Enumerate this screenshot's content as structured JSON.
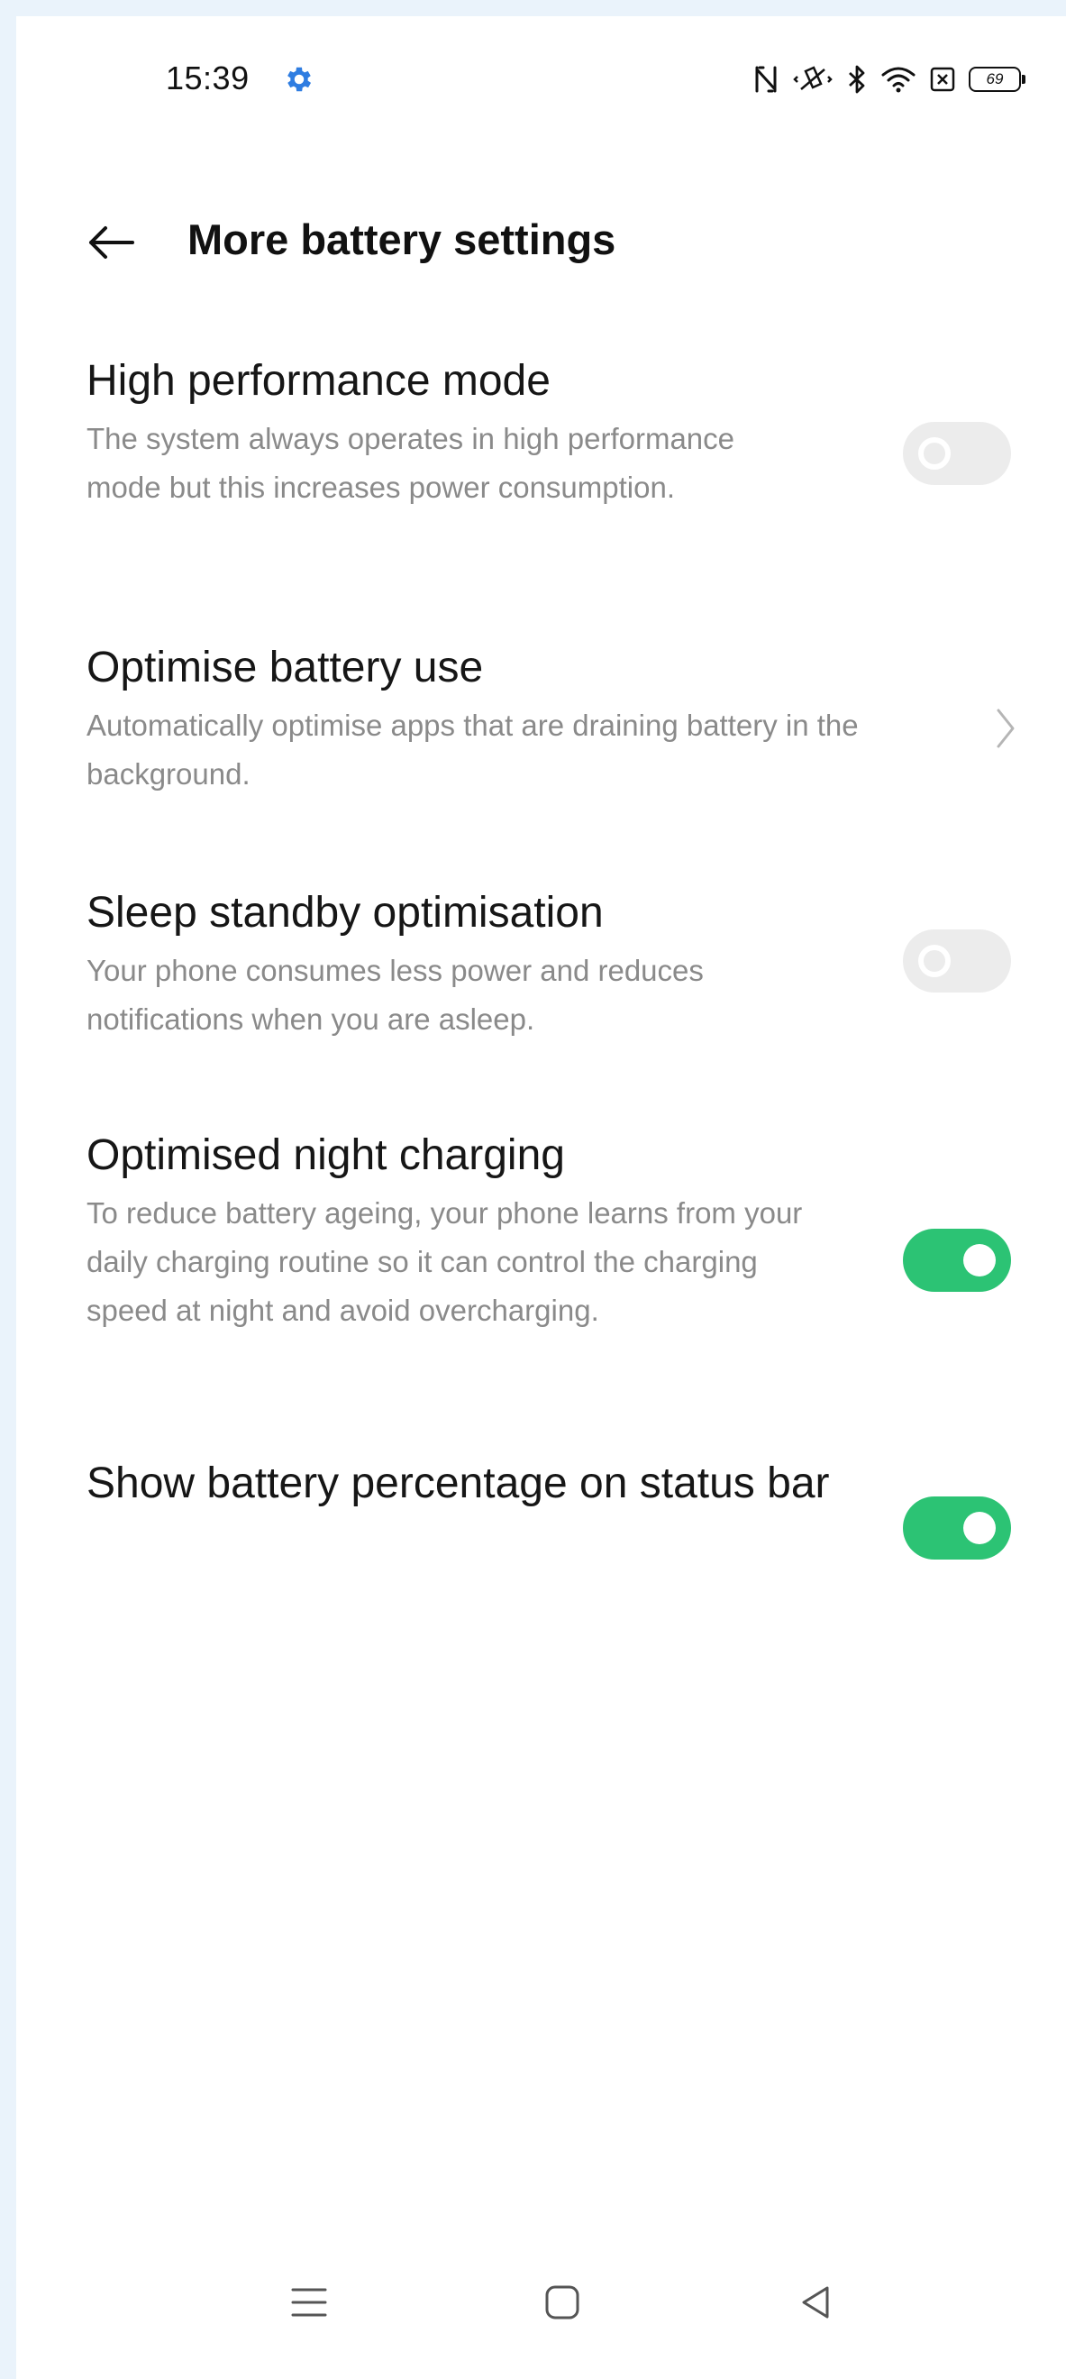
{
  "status_bar": {
    "time": "15:39",
    "battery_level": "69",
    "icons": [
      "settings-gear-icon",
      "nfc-icon",
      "vibrate-icon",
      "bluetooth-icon",
      "wifi-icon",
      "sim-x-icon",
      "battery-icon"
    ],
    "gear_color": "#2f7de1"
  },
  "header": {
    "title": "More battery settings",
    "back_icon": "arrow-left-icon"
  },
  "settings": [
    {
      "title": "High performance mode",
      "description": "The system always operates in high performance mode but this increases power consumption.",
      "control": "toggle",
      "enabled": false
    },
    {
      "title": "Optimise battery use",
      "description": "Automatically optimise apps that are draining battery in the background.",
      "control": "chevron"
    },
    {
      "title": "Sleep standby optimisation",
      "description": "Your phone consumes less power and reduces notifications when you are asleep.",
      "control": "toggle",
      "enabled": false
    },
    {
      "title": "Optimised night charging",
      "description": "To reduce battery ageing, your phone learns from your daily charging routine so it can control the charging speed at night and avoid overcharging.",
      "control": "toggle",
      "enabled": true
    },
    {
      "title": "Show battery percentage on status bar",
      "control": "toggle",
      "enabled": true
    }
  ],
  "colors": {
    "toggle_on": "#2cc374",
    "toggle_off": "#ececec",
    "page_background": "#eaf3fb"
  },
  "nav_bar": {
    "icons": [
      "menu-icon",
      "home-icon",
      "back-triangle-icon"
    ]
  }
}
